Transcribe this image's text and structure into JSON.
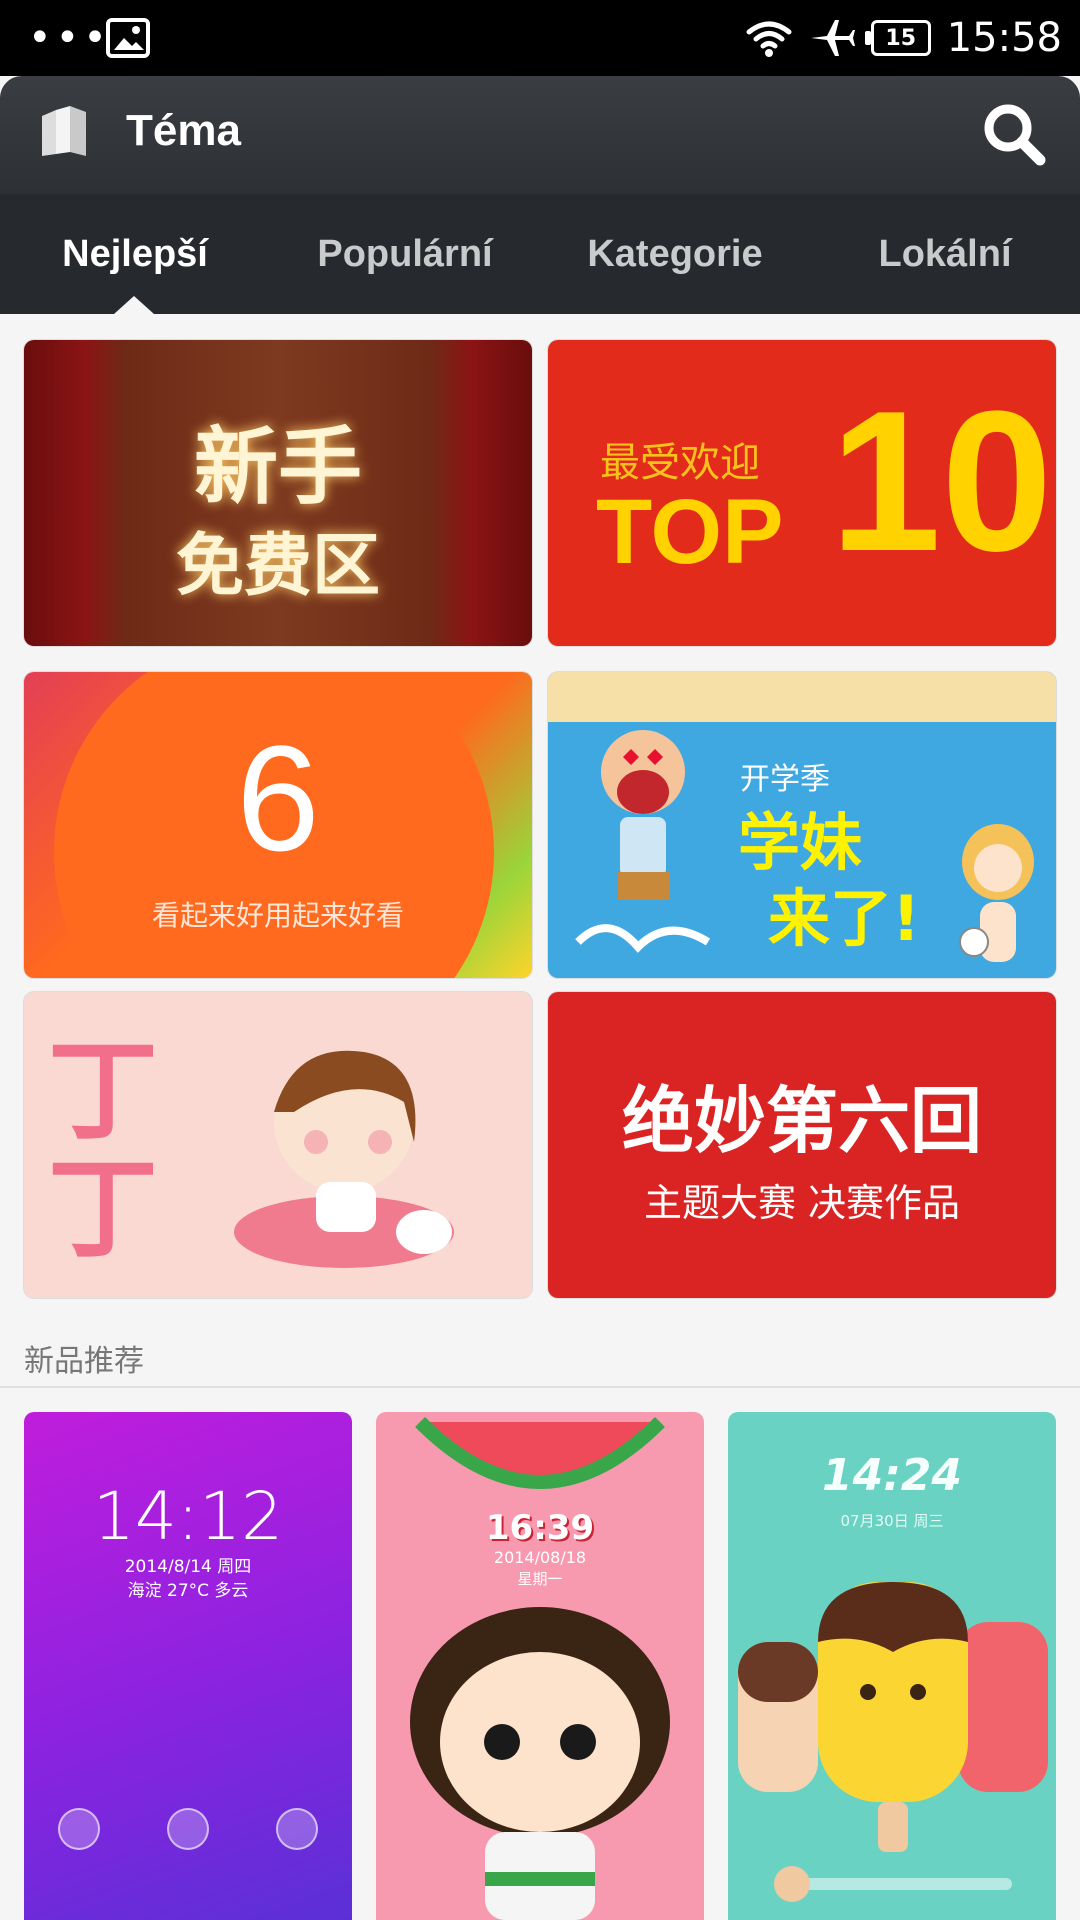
{
  "status_bar": {
    "time": "15:58",
    "battery": "15",
    "icons": [
      "more-dots-icon",
      "image-notification-icon",
      "wifi-icon",
      "airplane-icon",
      "battery-icon"
    ]
  },
  "header": {
    "title": "Téma",
    "logo_icon": "theme-app-icon",
    "search_icon": "search-icon"
  },
  "tabs": [
    {
      "label": "Nejlepší",
      "active": true
    },
    {
      "label": "Populární",
      "active": false
    },
    {
      "label": "Kategorie",
      "active": false
    },
    {
      "label": "Lokální",
      "active": false
    }
  ],
  "banners": {
    "b1": {
      "line1": "新手",
      "line2": "免费区"
    },
    "b2": {
      "sub": "最受欢迎",
      "top": "TOP",
      "ten": "10"
    },
    "b3": {
      "number": "6",
      "sub": "看起来好用起来好看"
    },
    "b4": {
      "line1": "开学季",
      "line2": "学妹",
      "line3": "来了!"
    },
    "b5": {
      "text": "丁丁"
    },
    "b6": {
      "line1": "绝妙第六回",
      "line2": "主题大赛 决赛作品"
    }
  },
  "section": {
    "title": "新品推荐"
  },
  "themes": {
    "t1": {
      "time": "14:12",
      "date": "2014/8/14 周四",
      "weather": "海淀 27°C 多云"
    },
    "t2": {
      "time": "16:39",
      "date": "2014/08/18",
      "day": "星期一"
    },
    "t3": {
      "time": "14:24",
      "date": "07月30日 周三"
    }
  },
  "colors": {
    "header_bg": "#2d3035",
    "tabs_bg": "#26292d",
    "banner_red": "#e32b1c",
    "accent_yellow": "#ffd200"
  }
}
